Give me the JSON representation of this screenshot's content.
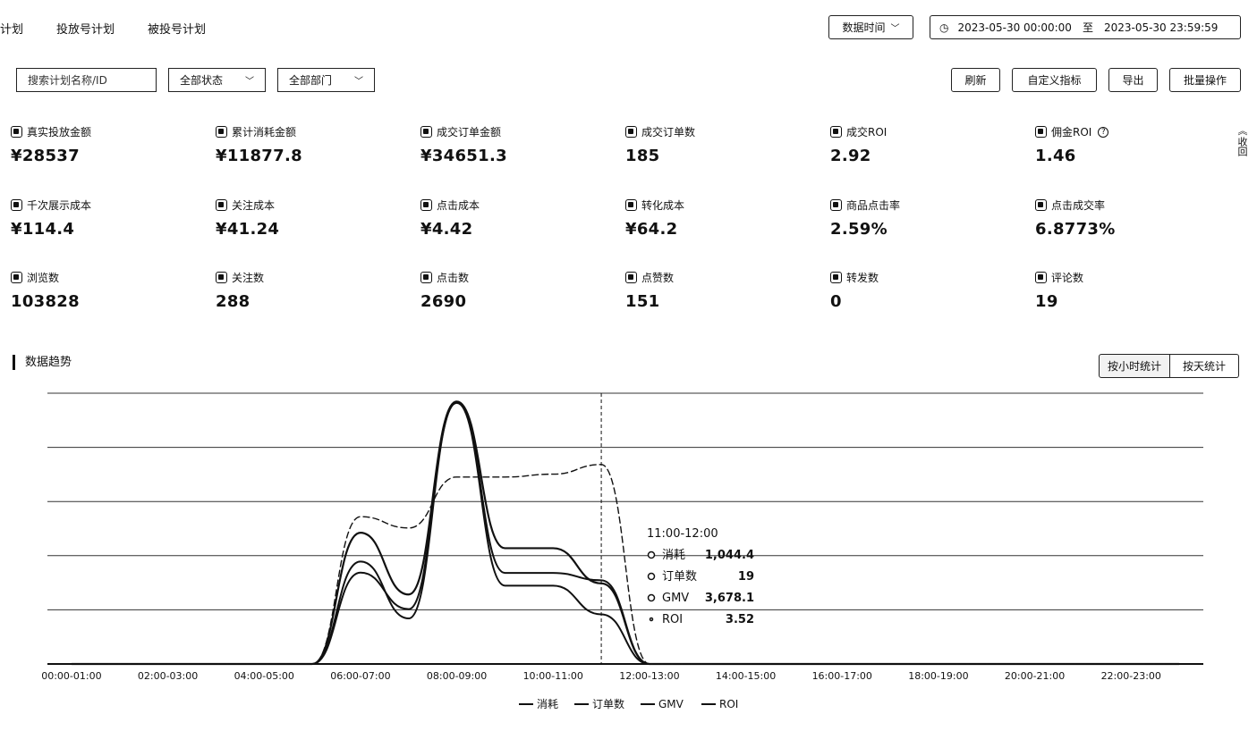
{
  "tabs": [
    "计划",
    "投放号计划",
    "被投号计划"
  ],
  "time_filter": {
    "label": "数据时间",
    "start": "2023-05-30 00:00:00",
    "sep": "至",
    "end": "2023-05-30 23:59:59"
  },
  "filters": {
    "search_placeholder": "搜索计划名称/ID",
    "status": "全部状态",
    "dept": "全部部门"
  },
  "toolbar": {
    "btn1": "刷新",
    "btn2": "自定义指标",
    "btn3": "导出",
    "btn4": "批量操作"
  },
  "collapse": "收回",
  "metrics": [
    {
      "label": "真实投放金额",
      "value": "¥28537"
    },
    {
      "label": "累计消耗金额",
      "value": "¥11877.8"
    },
    {
      "label": "成交订单金额",
      "value": "¥34651.3"
    },
    {
      "label": "成交订单数",
      "value": "185"
    },
    {
      "label": "成交ROI",
      "value": "2.92"
    },
    {
      "label": "佣金ROI",
      "value": "1.46"
    },
    {
      "label": "千次展示成本",
      "value": "¥114.4"
    },
    {
      "label": "关注成本",
      "value": "¥41.24"
    },
    {
      "label": "点击成本",
      "value": "¥4.42"
    },
    {
      "label": "转化成本",
      "value": "¥64.2"
    },
    {
      "label": "商品点击率",
      "value": "2.59%"
    },
    {
      "label": "点击成交率",
      "value": "6.8773%"
    },
    {
      "label": "浏览数",
      "value": "103828"
    },
    {
      "label": "关注数",
      "value": "288"
    },
    {
      "label": "点击数",
      "value": "2690"
    },
    {
      "label": "点赞数",
      "value": "151"
    },
    {
      "label": "转发数",
      "value": "0"
    },
    {
      "label": "评论数",
      "value": "19"
    }
  ],
  "trend": {
    "title": "数据趋势",
    "seg1": "按小时统计",
    "seg2": "按天统计"
  },
  "chart_data": {
    "type": "line",
    "categories": [
      "00:00-01:00",
      "01:00-02:00",
      "02:00-03:00",
      "03:00-04:00",
      "04:00-05:00",
      "05:00-06:00",
      "06:00-07:00",
      "07:00-08:00",
      "08:00-09:00",
      "09:00-10:00",
      "10:00-11:00",
      "11:00-12:00",
      "12:00-13:00",
      "13:00-14:00",
      "14:00-15:00",
      "15:00-16:00",
      "16:00-17:00",
      "17:00-18:00",
      "18:00-19:00",
      "19:00-20:00",
      "20:00-21:00",
      "21:00-22:00",
      "22:00-23:00",
      "23:00-24:00"
    ],
    "tick_labels": [
      "00:00-01:00",
      "02:00-03:00",
      "04:00-05:00",
      "06:00-07:00",
      "08:00-09:00",
      "10:00-11:00",
      "12:00-13:00",
      "14:00-15:00",
      "16:00-17:00",
      "18:00-19:00",
      "20:00-21:00",
      "22:00-23:00"
    ],
    "series": [
      {
        "name": "消耗",
        "values": [
          0,
          0,
          0,
          0,
          0,
          0,
          1700,
          900,
          3400,
          1500,
          1500,
          1044.4,
          0,
          0,
          0,
          0,
          0,
          0,
          0,
          0,
          0,
          0,
          0,
          0
        ]
      },
      {
        "name": "订单数",
        "values": [
          0,
          0,
          0,
          0,
          0,
          0,
          35,
          21,
          100,
          30,
          30,
          19,
          0,
          0,
          0,
          0,
          0,
          0,
          0,
          0,
          0,
          0,
          0,
          0
        ]
      },
      {
        "name": "GMV",
        "values": [
          0,
          0,
          0,
          0,
          0,
          0,
          4500,
          2000,
          11500,
          4000,
          4000,
          3678.1,
          0,
          0,
          0,
          0,
          0,
          0,
          0,
          0,
          0,
          0,
          0,
          0
        ]
      },
      {
        "name": "ROI",
        "values": [
          0,
          0,
          0,
          0,
          0,
          0,
          2.6,
          2.4,
          3.3,
          3.3,
          3.35,
          3.52,
          0,
          0,
          0,
          0,
          0,
          0,
          0,
          0,
          0,
          0,
          0,
          0
        ]
      }
    ],
    "tooltip": {
      "title": "11:00-12:00",
      "rows": [
        {
          "name": "消耗",
          "value": "1,044.4"
        },
        {
          "name": "订单数",
          "value": "19"
        },
        {
          "name": "GMV",
          "value": "3,678.1"
        },
        {
          "name": "ROI",
          "value": "3.52"
        }
      ]
    },
    "legend": [
      "消耗",
      "订单数",
      "GMV",
      "ROI"
    ],
    "grid": true,
    "legend_position": "bottom"
  }
}
